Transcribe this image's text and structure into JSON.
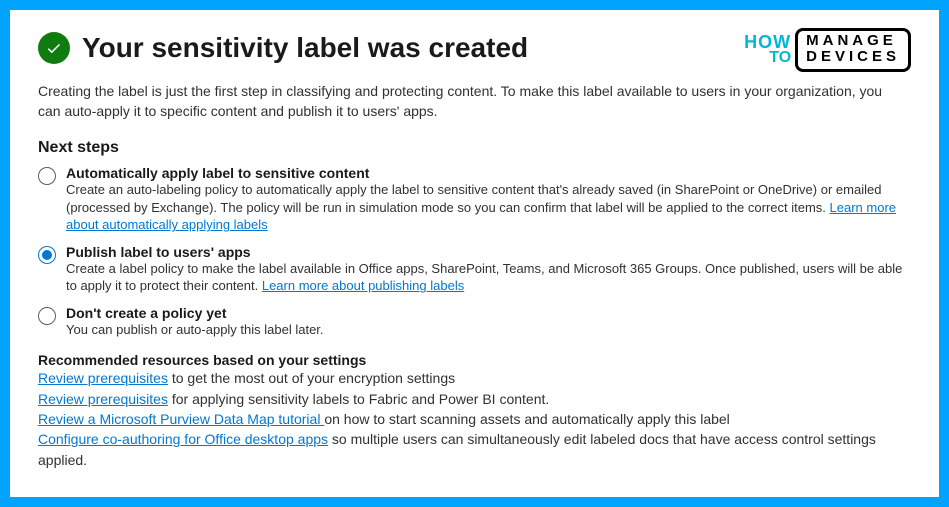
{
  "brand": {
    "how": "HOW",
    "to": "TO",
    "line1": "MANAGE",
    "line2": "DEVICES"
  },
  "title": "Your sensitivity label was created",
  "intro": "Creating the label is just the first step in classifying and protecting content. To make this label available to users in your organization, you can auto-apply it to specific content and publish it to users' apps.",
  "next_steps_heading": "Next steps",
  "options": {
    "auto": {
      "title": "Automatically apply label to sensitive content",
      "desc_before": "Create an auto-labeling policy to automatically apply the label to sensitive content that's already saved (in SharePoint or OneDrive) or emailed (processed by Exchange). The policy will be run in simulation mode so you can confirm that label will be applied to the correct items. ",
      "link": "Learn more about automatically applying labels"
    },
    "publish": {
      "title": "Publish label to users' apps",
      "desc_before": "Create a label policy to make the label available in Office apps, SharePoint, Teams, and Microsoft 365 Groups. Once published, users will be able to apply it to protect their content. ",
      "link": "Learn more about publishing labels"
    },
    "none": {
      "title": "Don't create a policy yet",
      "desc": "You can publish or auto-apply this label later."
    }
  },
  "recommended": {
    "heading": "Recommended resources based on your settings",
    "items": [
      {
        "link": "Review prerequisites",
        "rest": " to get the most out of your encryption settings"
      },
      {
        "link": "Review prerequisites",
        "rest": " for applying sensitivity labels to Fabric and Power BI content."
      },
      {
        "link": "Review a Microsoft Purview Data Map tutorial ",
        "rest": "on how to start scanning assets and automatically apply this label"
      },
      {
        "link": "Configure co-authoring for Office desktop apps",
        "rest": " so multiple users can simultaneously edit labeled docs that have access control settings applied."
      }
    ]
  }
}
